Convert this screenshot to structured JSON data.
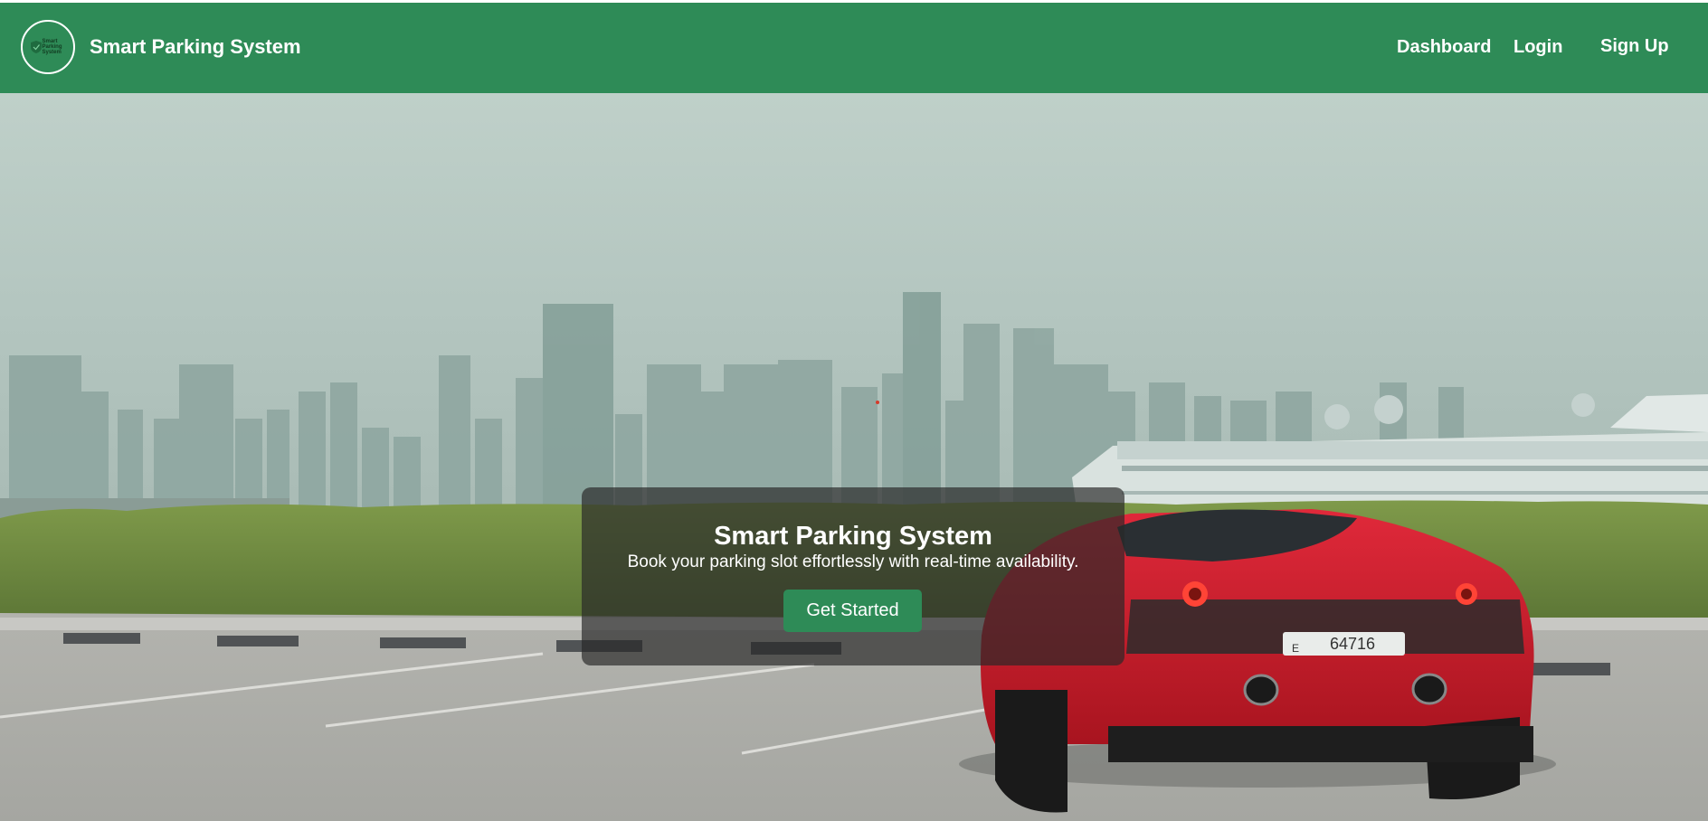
{
  "navbar": {
    "logo_text": [
      "Smart",
      "Parking",
      "System"
    ],
    "brand_title": "Smart Parking System",
    "links": [
      "Dashboard",
      "Login",
      "Sign Up"
    ],
    "background_color": "#2e8b57"
  },
  "hero": {
    "title": "Smart Parking System",
    "subtitle": "Book your parking slot effortlessly with real-time availability.",
    "cta_label": "Get Started",
    "plate_text": "64716",
    "plate_code": "E",
    "accent_color": "#2e8b57"
  }
}
